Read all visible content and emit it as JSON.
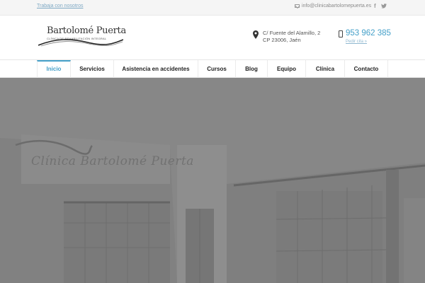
{
  "topbar": {
    "work_link": "Trabaja con nosotros",
    "email": "info@clinicabartolomepuerta.es",
    "social": [
      {
        "name": "facebook-icon",
        "glyph": "f"
      },
      {
        "name": "twitter-icon",
        "glyph": "𝕥"
      }
    ]
  },
  "header": {
    "logo": {
      "name": "Bartolomé Puerta",
      "subtitle": "Clínica de Rehabilitación Integral"
    },
    "address": {
      "line1": "C/ Fuente del Alamillo, 2",
      "line2": "CP 23006, Jaén"
    },
    "phone": {
      "number": "953 962 385",
      "cta": "Pedir cita »"
    }
  },
  "nav": {
    "items": [
      {
        "label": "Inicio",
        "active": true
      },
      {
        "label": "Servicios",
        "active": false
      },
      {
        "label": "Asistencia en accidentes",
        "active": false
      },
      {
        "label": "Cursos",
        "active": false
      },
      {
        "label": "Blog",
        "active": false
      },
      {
        "label": "Equipo",
        "active": false
      },
      {
        "label": "Clínica",
        "active": false
      },
      {
        "label": "Contacto",
        "active": false
      }
    ]
  },
  "hero": {
    "sign_text": "Clínica Bartolomé Puerta"
  },
  "colors": {
    "accent": "#45a0c9",
    "topbar_bg": "#f5f5f5",
    "hero_overlay": "#858585"
  }
}
